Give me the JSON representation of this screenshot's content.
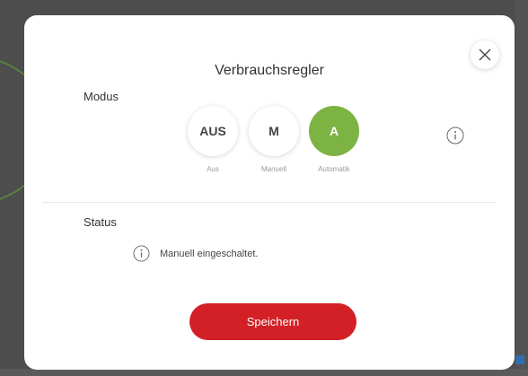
{
  "dialog": {
    "title": "Verbrauchsregler",
    "close_icon": "close-icon"
  },
  "modus": {
    "label": "Modus",
    "options": [
      {
        "code": "AUS",
        "caption": "Aus",
        "active": false
      },
      {
        "code": "M",
        "caption": "Manuell",
        "active": false
      },
      {
        "code": "A",
        "caption": "Automatik",
        "active": true
      }
    ],
    "info_icon": "info-icon",
    "active_color": "#7cb342"
  },
  "status": {
    "label": "Status",
    "message": "Manuell eingeschaltet.",
    "info_icon": "info-icon"
  },
  "actions": {
    "save_label": "Speichern",
    "save_color": "#d32026"
  }
}
